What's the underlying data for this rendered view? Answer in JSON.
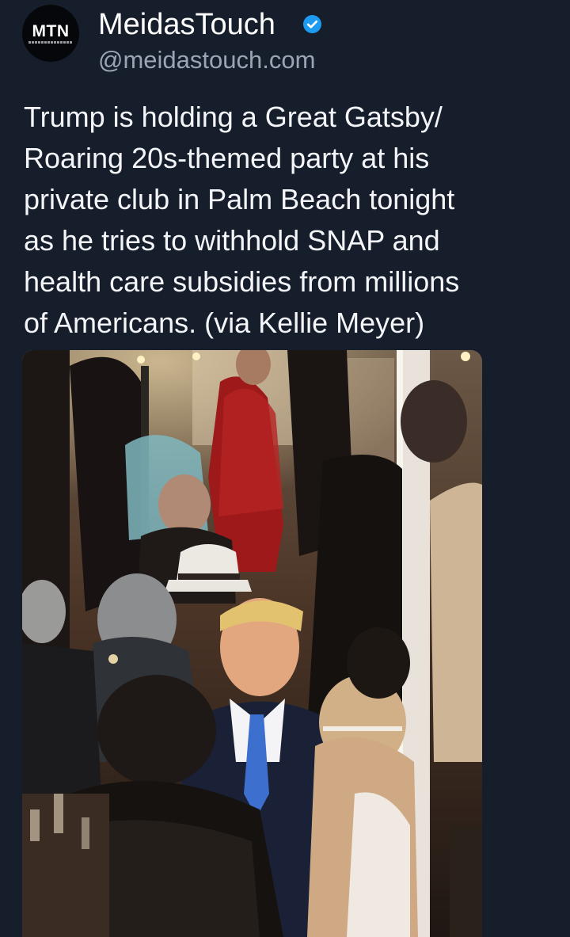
{
  "author": {
    "avatar_text": "MTN",
    "display_name": "MeidasTouch",
    "handle": "@meidastouch.com",
    "verified": true,
    "verified_color": "#1d9bf0"
  },
  "post": {
    "text": "Trump is holding a Great Gatsby/\nRoaring 20s-themed party at his\nprivate club in Palm Beach tonight\nas he tries to withhold SNAP and\nhealth care subsidies from millions\nof Americans. (via Kellie Meyer)"
  },
  "theme": {
    "background": "#161e2b",
    "text": "#f3f5f8",
    "secondary_text": "#9aa6b6"
  }
}
